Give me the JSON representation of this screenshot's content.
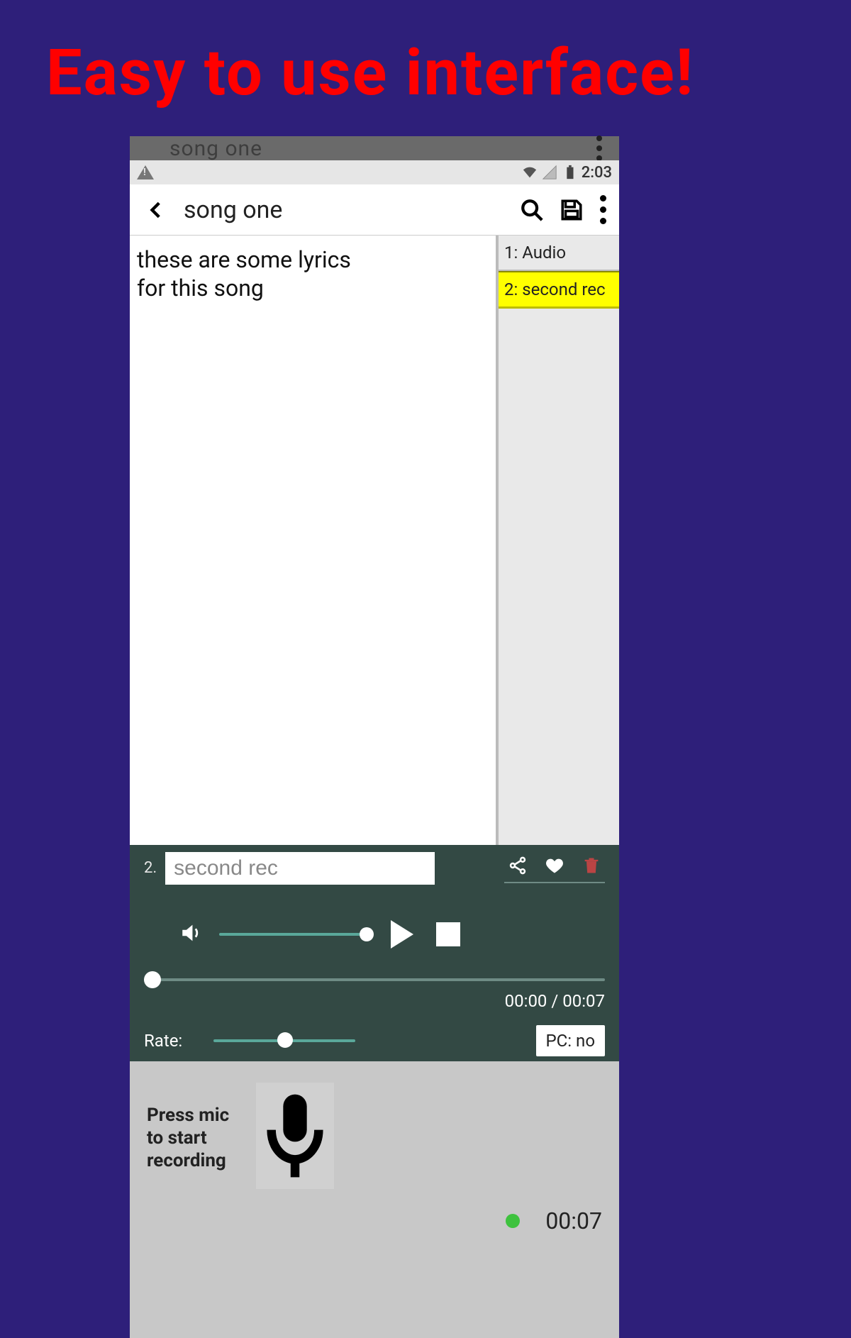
{
  "headline": "Easy to use interface!",
  "status_bar": {
    "time": "2:03"
  },
  "ghost_header": {
    "title": "song one"
  },
  "app_bar": {
    "title": "song one"
  },
  "lyrics": "these are some lyrics\nfor this song",
  "tracks": [
    {
      "label": "1: Audio",
      "selected": false
    },
    {
      "label": "2: second rec",
      "selected": true
    }
  ],
  "player": {
    "track_index": "2.",
    "title_input_value": "second rec",
    "time_display": "00:00 / 00:07",
    "rate_label": "Rate:",
    "pc_chip": "PC: no"
  },
  "recorder": {
    "hint": "Press mic to start recording",
    "time": "00:07"
  }
}
